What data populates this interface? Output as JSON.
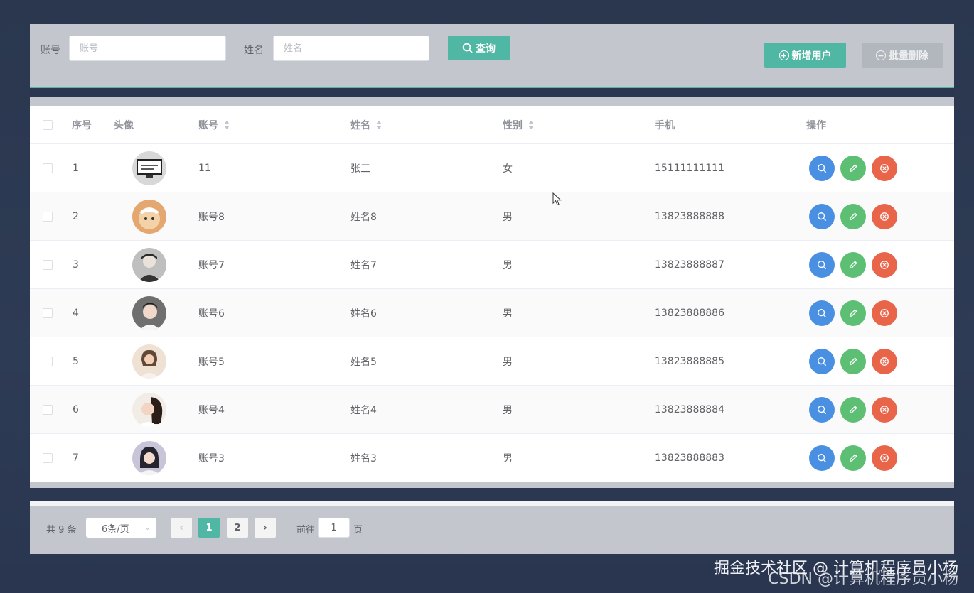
{
  "search": {
    "account_label": "账号",
    "account_placeholder": "账号",
    "name_label": "姓名",
    "name_placeholder": "姓名",
    "query_label": "查询",
    "add_label": "新增用户",
    "batch_delete_label": "批量删除"
  },
  "table": {
    "headers": {
      "index": "序号",
      "avatar": "头像",
      "account": "账号",
      "name": "姓名",
      "gender": "性别",
      "phone": "手机",
      "actions": "操作"
    },
    "rows": [
      {
        "index": "1",
        "account": "11",
        "name": "张三",
        "gender": "女",
        "phone": "15111111111"
      },
      {
        "index": "2",
        "account": "账号8",
        "name": "姓名8",
        "gender": "男",
        "phone": "13823888888"
      },
      {
        "index": "3",
        "account": "账号7",
        "name": "姓名7",
        "gender": "男",
        "phone": "13823888887"
      },
      {
        "index": "4",
        "account": "账号6",
        "name": "姓名6",
        "gender": "男",
        "phone": "13823888886"
      },
      {
        "index": "5",
        "account": "账号5",
        "name": "姓名5",
        "gender": "男",
        "phone": "13823888885"
      },
      {
        "index": "6",
        "account": "账号4",
        "name": "姓名4",
        "gender": "男",
        "phone": "13823888884"
      },
      {
        "index": "7",
        "account": "账号3",
        "name": "姓名3",
        "gender": "男",
        "phone": "13823888883"
      }
    ]
  },
  "pagination": {
    "total": "共 9 条",
    "page_size": "6条/页",
    "pages": [
      "1",
      "2"
    ],
    "current_page": "1",
    "goto_label": "前往",
    "goto_value": "1",
    "page_suffix": "页"
  },
  "watermark": {
    "line1": "掘金技术社区 @ 计算机程序员小杨",
    "line2": "CSDN @计算机程序员小杨"
  },
  "colors": {
    "primary": "#4fb7a3",
    "view": "#4a90e2",
    "edit": "#5cbf74",
    "delete": "#e8654a"
  },
  "icons": {
    "query": "search-icon",
    "add": "plus-circle-icon",
    "batch_delete": "minus-circle-icon",
    "view": "search-icon",
    "edit": "pencil-icon",
    "delete": "close-circle-icon"
  }
}
